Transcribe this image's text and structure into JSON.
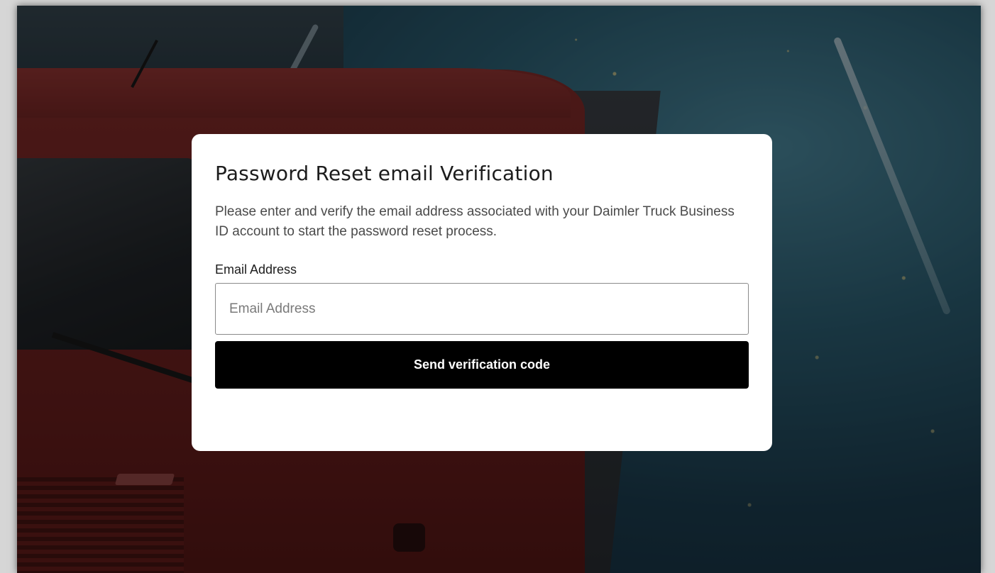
{
  "card": {
    "title": "Password Reset email Verification",
    "description": "Please enter and verify the email address associated with your Daimler Truck Business ID account to start the password reset process.",
    "email_label": "Email Address",
    "email_placeholder": "Email Address",
    "email_value": "",
    "send_button_label": "Send verification code"
  },
  "colors": {
    "button_bg": "#000000",
    "button_text": "#ffffff",
    "card_bg": "#ffffff",
    "truck_red": "#7a2624"
  }
}
